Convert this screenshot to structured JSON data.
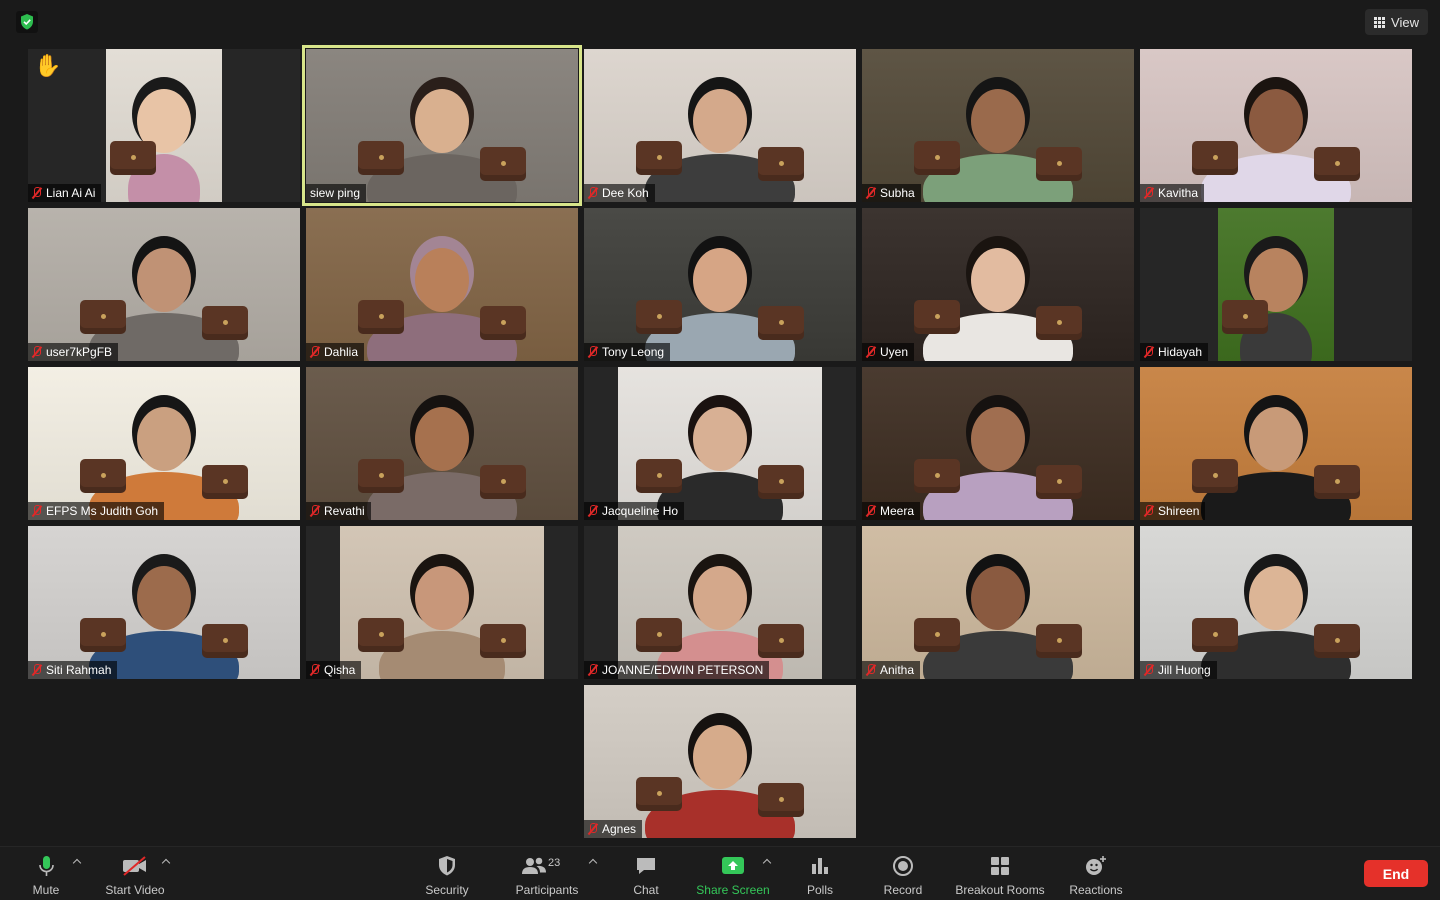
{
  "topbar": {
    "view_label": "View"
  },
  "participants": [
    {
      "name": "Lian Ai Ai",
      "muted": true,
      "raised_hand": true,
      "active": false,
      "bg": "#e3ded6",
      "shirt": "#c48fa8",
      "skin": "#e8c4a6",
      "hair": "#1a1a1a",
      "frame": "pillar"
    },
    {
      "name": "siew ping",
      "muted": false,
      "raised_hand": false,
      "active": true,
      "bg": "#8b8680",
      "shirt": "#6b6560",
      "skin": "#d9b08f",
      "hair": "#2a1f1a",
      "frame": "full"
    },
    {
      "name": "Dee Koh",
      "muted": true,
      "raised_hand": false,
      "active": false,
      "bg": "#ddd6cf",
      "shirt": "#3d3d3d",
      "skin": "#d4a98b",
      "hair": "#151515",
      "frame": "full"
    },
    {
      "name": "Subha",
      "muted": true,
      "raised_hand": false,
      "active": false,
      "bg": "#5e5545",
      "shirt": "#7ca07a",
      "skin": "#9a6a4c",
      "hair": "#151515",
      "frame": "full"
    },
    {
      "name": "Kavitha",
      "muted": true,
      "raised_hand": false,
      "active": false,
      "bg": "#d9c8c6",
      "shirt": "#e0d7e8",
      "skin": "#8b5a40",
      "hair": "#1b1410",
      "frame": "full"
    },
    {
      "name": "user7kPgFB",
      "muted": true,
      "raised_hand": false,
      "active": false,
      "bg": "#b8b3ac",
      "shirt": "#6f6a66",
      "skin": "#c09275",
      "hair": "#141414",
      "frame": "full"
    },
    {
      "name": "Dahlia",
      "muted": true,
      "raised_hand": false,
      "active": false,
      "bg": "#8a6f52",
      "shirt": "#8e6e7c",
      "skin": "#b9805a",
      "hair": "#a38594",
      "frame": "full"
    },
    {
      "name": "Tony Leong",
      "muted": true,
      "raised_hand": false,
      "active": false,
      "bg": "#4a4a46",
      "shirt": "#9aa7b1",
      "skin": "#d6a585",
      "hair": "#121212",
      "frame": "full"
    },
    {
      "name": "Uyen",
      "muted": true,
      "raised_hand": false,
      "active": false,
      "bg": "#3c3430",
      "shirt": "#e9e6e2",
      "skin": "#e2bba0",
      "hair": "#1a1410",
      "frame": "full"
    },
    {
      "name": "Hidayah",
      "muted": true,
      "raised_hand": false,
      "active": false,
      "bg": "#4d7a2f",
      "shirt": "#3a3a3a",
      "skin": "#b8835f",
      "hair": "#1a1a1a",
      "frame": "pillar-narrow"
    },
    {
      "name": "EFPS Ms Judith Goh",
      "muted": true,
      "raised_hand": false,
      "active": false,
      "bg": "#f3efe4",
      "shirt": "#cf7a3a",
      "skin": "#caa080",
      "hair": "#161616",
      "frame": "full"
    },
    {
      "name": "Revathi",
      "muted": true,
      "raised_hand": false,
      "active": false,
      "bg": "#6b5c4d",
      "shirt": "#7a6b67",
      "skin": "#a6714e",
      "hair": "#161210",
      "frame": "full"
    },
    {
      "name": "Jacqueline Ho",
      "muted": true,
      "raised_hand": false,
      "active": false,
      "bg": "#e6e3df",
      "shirt": "#2a2a2a",
      "skin": "#d8b094",
      "hair": "#1a1210",
      "frame": "pillar"
    },
    {
      "name": "Meera",
      "muted": true,
      "raised_hand": false,
      "active": false,
      "bg": "#4a3b30",
      "shirt": "#b8a0c0",
      "skin": "#a06e50",
      "hair": "#161210",
      "frame": "full"
    },
    {
      "name": "Shireen",
      "muted": true,
      "raised_hand": false,
      "active": false,
      "bg": "#c9874a",
      "shirt": "#1a1a1a",
      "skin": "#c89a78",
      "hair": "#141414",
      "frame": "full"
    },
    {
      "name": "Siti Rahmah",
      "muted": true,
      "raised_hand": false,
      "active": false,
      "bg": "#d6d4d2",
      "shirt": "#2e4f7a",
      "skin": "#9c6b4c",
      "hair": "#1a1a1a",
      "frame": "full"
    },
    {
      "name": "Qisha",
      "muted": true,
      "raised_hand": false,
      "active": false,
      "bg": "#d3c6b6",
      "shirt": "#a58b73",
      "skin": "#c8977a",
      "hair": "#1a1410",
      "frame": "pillar"
    },
    {
      "name": "JOANNE/EDWIN PETERSON",
      "muted": true,
      "raised_hand": false,
      "active": false,
      "bg": "#cfcac2",
      "shirt": "#d48f8f",
      "skin": "#d4a88b",
      "hair": "#1a1410",
      "frame": "pillar"
    },
    {
      "name": "Anitha",
      "muted": true,
      "raised_hand": false,
      "active": false,
      "bg": "#d0bda4",
      "shirt": "#3a3a3a",
      "skin": "#8a5a40",
      "hair": "#121212",
      "frame": "full"
    },
    {
      "name": "Jill Huong",
      "muted": true,
      "raised_hand": false,
      "active": false,
      "bg": "#d8d8d6",
      "shirt": "#2e2e2e",
      "skin": "#dcb596",
      "hair": "#181818",
      "frame": "full"
    },
    {
      "name": "Agnes",
      "muted": true,
      "raised_hand": false,
      "active": false,
      "bg": "#d4cec6",
      "shirt": "#a8302a",
      "skin": "#d6ab8b",
      "hair": "#161210",
      "frame": "full"
    }
  ],
  "toolbar": {
    "mute": "Mute",
    "start_video": "Start Video",
    "security": "Security",
    "participants": "Participants",
    "participant_count": "23",
    "chat": "Chat",
    "share_screen": "Share Screen",
    "polls": "Polls",
    "record": "Record",
    "breakout_rooms": "Breakout Rooms",
    "reactions": "Reactions",
    "end": "End"
  },
  "colors": {
    "active_speaker": "#d8e58a",
    "share_green": "#34c759",
    "end_red": "#e5312a",
    "muted_red": "#e02828"
  }
}
